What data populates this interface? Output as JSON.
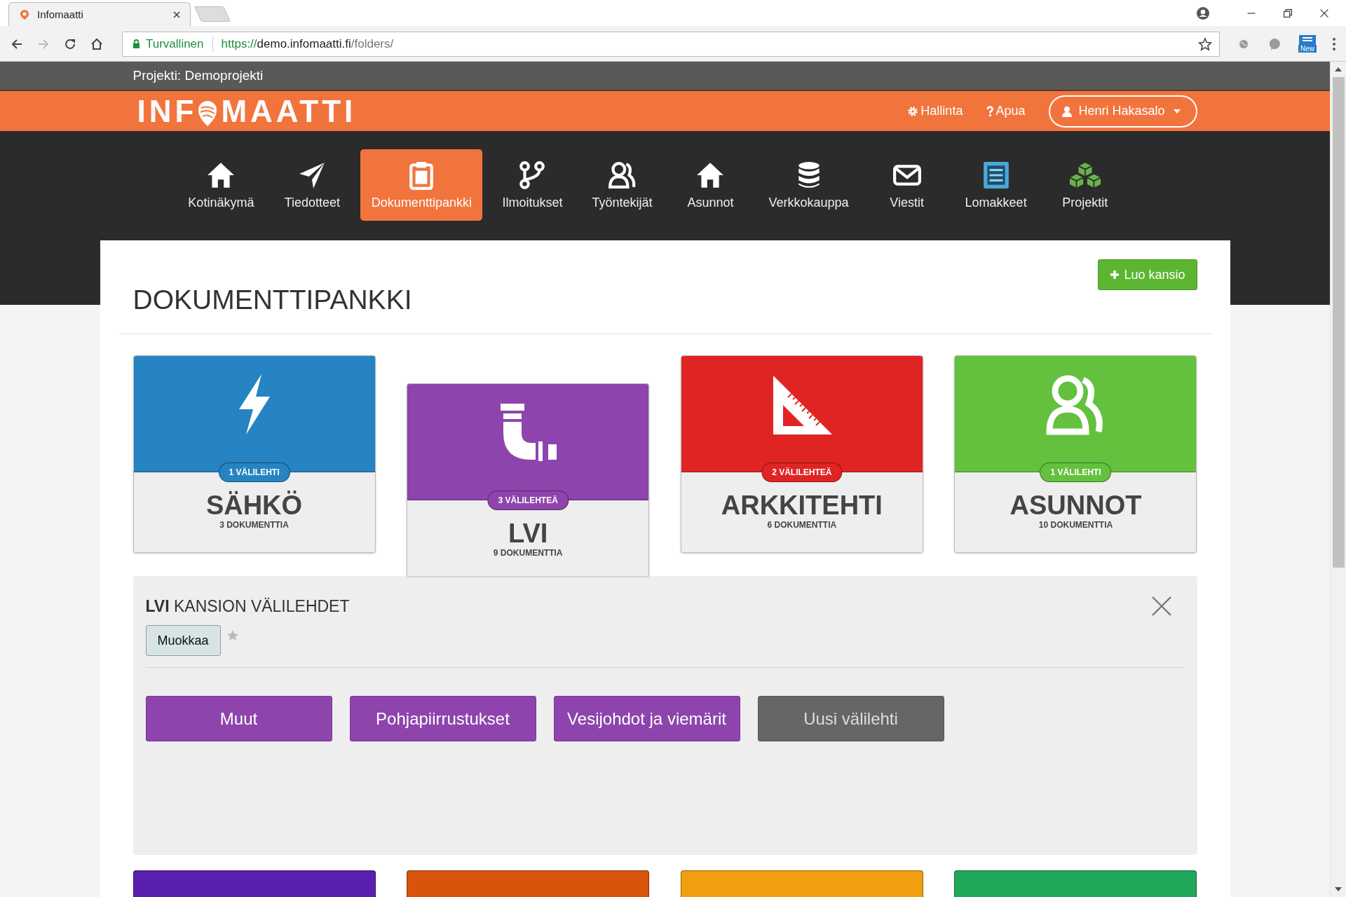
{
  "browser": {
    "tab_title": "Infomaatti",
    "security_label": "Turvallinen",
    "url": {
      "scheme": "https://",
      "host": "demo.infomaatti.fi",
      "path": "/folders/"
    },
    "extension_badge": "New"
  },
  "project_bar": {
    "label": "Projekti: Demoprojekti"
  },
  "header": {
    "logo": {
      "before": "INF",
      "after": "MAATTI"
    },
    "links": [
      "Hallinta",
      "Apua"
    ],
    "user": "Henri Hakasalo"
  },
  "nav": [
    {
      "label": "Kotinäkymä",
      "selected": false
    },
    {
      "label": "Tiedotteet",
      "selected": false
    },
    {
      "label": "Dokumenttipankki",
      "selected": true
    },
    {
      "label": "Ilmoitukset",
      "selected": false
    },
    {
      "label": "Työntekijät",
      "selected": false
    },
    {
      "label": "Asunnot",
      "selected": false
    },
    {
      "label": "Verkkokauppa",
      "selected": false
    },
    {
      "label": "Viestit",
      "selected": false
    },
    {
      "label": "Lomakkeet",
      "selected": false
    },
    {
      "label": "Projektit",
      "selected": false
    }
  ],
  "page": {
    "title": "DOKUMENTTIPANKKI",
    "create_button": "Luo kansio"
  },
  "folders": [
    {
      "name": "SÄHKÖ",
      "badge": "1 VÄLILEHTI",
      "count": "3 DOKUMENTTIA",
      "color": "#2584c1",
      "selected": false
    },
    {
      "name": "LVI",
      "badge": "3 VÄLILEHTEÄ",
      "count": "9 DOKUMENTTIA",
      "color": "#8e44ad",
      "selected": true
    },
    {
      "name": "ARKKITEHTI",
      "badge": "2 VÄLILEHTEÄ",
      "count": "6 DOKUMENTTIA",
      "color": "#e02424",
      "selected": false
    },
    {
      "name": "ASUNNOT",
      "badge": "1 VÄLILEHTI",
      "count": "10 DOKUMENTTIA",
      "color": "#63c13e",
      "selected": false
    }
  ],
  "tabs_panel": {
    "heading": "**LVI** KANSION VÄLILEHDET",
    "edit_button": "Muokkaa",
    "favorite": false,
    "tabs": [
      {
        "label": "Muut",
        "kind": "tab"
      },
      {
        "label": "Pohjapiirrustukset",
        "kind": "tab"
      },
      {
        "label": "Vesijohdot ja viemärit",
        "kind": "tab"
      },
      {
        "label": "Uusi välilehti",
        "kind": "new"
      }
    ]
  },
  "more_folders": [
    {
      "color": "#5b1fb0"
    },
    {
      "color": "#d9540a"
    },
    {
      "color": "#f29f0f"
    },
    {
      "color": "#21a85b"
    }
  ]
}
